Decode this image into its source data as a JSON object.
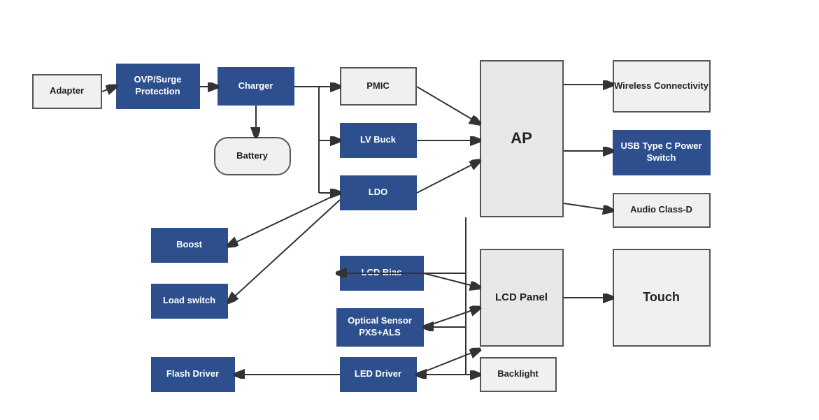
{
  "blocks": {
    "adapter": {
      "label": "Adapter"
    },
    "ovp": {
      "label": "OVP/Surge Protection"
    },
    "charger": {
      "label": "Charger"
    },
    "battery": {
      "label": "Battery"
    },
    "pmic": {
      "label": "PMIC"
    },
    "lv_buck": {
      "label": "LV Buck"
    },
    "ldo": {
      "label": "LDO"
    },
    "boost": {
      "label": "Boost"
    },
    "load_switch": {
      "label": "Load switch"
    },
    "lcd_bias": {
      "label": "LCD Bias"
    },
    "optical_sensor": {
      "label": "Optical Sensor PXS+ALS"
    },
    "flash_driver": {
      "label": "Flash Driver"
    },
    "led_driver": {
      "label": "LED Driver"
    },
    "ap": {
      "label": "AP"
    },
    "lcd_panel": {
      "label": "LCD Panel"
    },
    "wireless": {
      "label": "Wireless Connectivity"
    },
    "usb": {
      "label": "USB Type C Power Switch"
    },
    "audio": {
      "label": "Audio Class-D"
    },
    "touch": {
      "label": "Touch"
    },
    "backlight": {
      "label": "Backlight"
    }
  }
}
